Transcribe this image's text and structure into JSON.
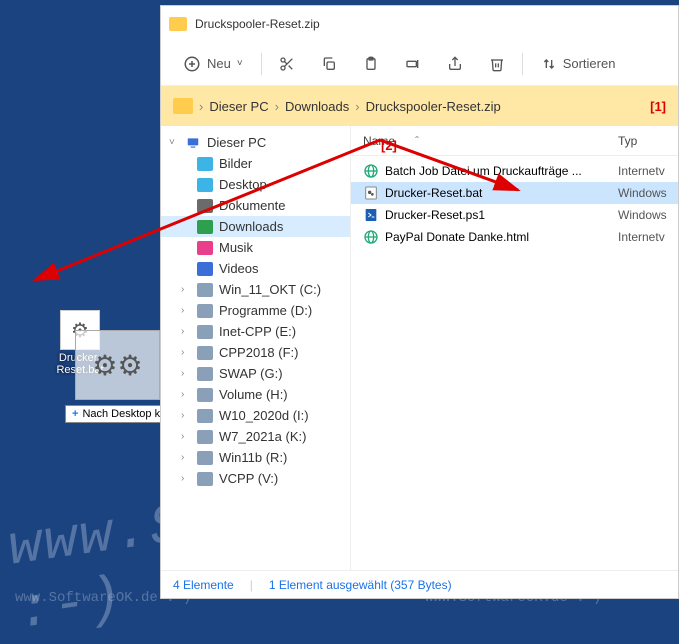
{
  "titlebar": {
    "title": "Druckspooler-Reset.zip"
  },
  "toolbar": {
    "new": "Neu",
    "sort": "Sortieren"
  },
  "breadcrumb": {
    "items": [
      "Dieser PC",
      "Downloads",
      "Druckspooler-Reset.zip"
    ],
    "sep": "›"
  },
  "markers": {
    "one": "[1]",
    "two": "[2]"
  },
  "nav": {
    "root": "Dieser PC",
    "items": [
      {
        "label": "Bilder",
        "color": "#3cb4e6"
      },
      {
        "label": "Desktop",
        "color": "#3cb4e6"
      },
      {
        "label": "Dokumente",
        "color": "#6b6b6b"
      },
      {
        "label": "Downloads",
        "color": "#2e9e4f",
        "selected": true
      },
      {
        "label": "Musik",
        "color": "#e83e8c"
      },
      {
        "label": "Videos",
        "color": "#3a6fd8"
      },
      {
        "label": "Win_11_OKT (C:)",
        "color": "#8aa0b8",
        "caret": true
      },
      {
        "label": "Programme (D:)",
        "color": "#8aa0b8",
        "caret": true
      },
      {
        "label": "Inet-CPP (E:)",
        "color": "#8aa0b8",
        "caret": true
      },
      {
        "label": "CPP2018 (F:)",
        "color": "#8aa0b8",
        "caret": true
      },
      {
        "label": "SWAP (G:)",
        "color": "#8aa0b8",
        "caret": true
      },
      {
        "label": "Volume (H:)",
        "color": "#8aa0b8",
        "caret": true
      },
      {
        "label": "W10_2020d (I:)",
        "color": "#8aa0b8",
        "caret": true
      },
      {
        "label": "W7_2021a (K:)",
        "color": "#8aa0b8",
        "caret": true
      },
      {
        "label": "Win11b (R:)",
        "color": "#8aa0b8",
        "caret": true
      },
      {
        "label": "VCPP (V:)",
        "color": "#8aa0b8",
        "caret": true
      }
    ]
  },
  "columns": {
    "name": "Name",
    "type": "Typ",
    "sort": "ˆ"
  },
  "files": [
    {
      "name": "Batch Job Datei um Druckaufträge ...",
      "type": "Internetv",
      "icon": "globe"
    },
    {
      "name": "Drucker-Reset.bat",
      "type": "Windows",
      "icon": "bat",
      "selected": true
    },
    {
      "name": "Drucker-Reset.ps1",
      "type": "Windows",
      "icon": "ps1"
    },
    {
      "name": "PayPal Donate Danke.html",
      "type": "Internetv",
      "icon": "globe"
    }
  ],
  "status": {
    "count": "4 Elemente",
    "sel": "1 Element ausgewählt (357 Bytes)"
  },
  "desktop": {
    "label": "Drucker-Reset.bat"
  },
  "drag": {
    "tooltip": "Nach Desktop kopieren"
  },
  "watermark": "www.SoftwareOK.de :-)"
}
